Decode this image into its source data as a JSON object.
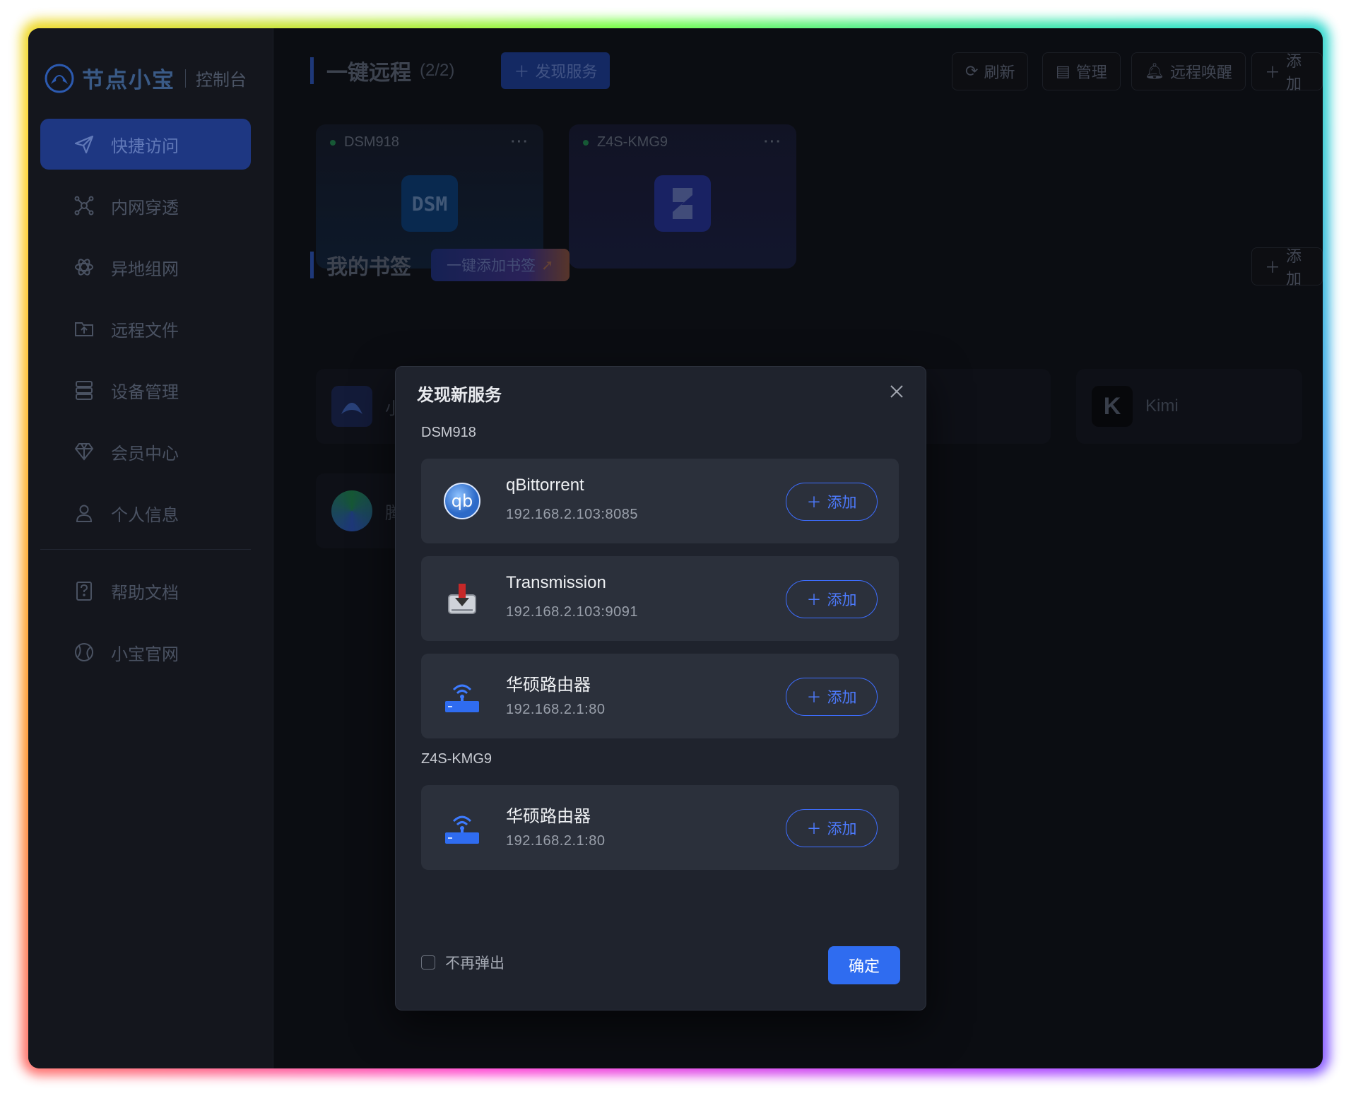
{
  "brand": {
    "name": "节点小宝",
    "subtitle": "控制台"
  },
  "sidebar": {
    "items": [
      {
        "label": "快捷访问",
        "icon": "send-icon",
        "active": true
      },
      {
        "label": "内网穿透",
        "icon": "network-icon"
      },
      {
        "label": "异地组网",
        "icon": "mesh-icon"
      },
      {
        "label": "远程文件",
        "icon": "folder-upload-icon"
      },
      {
        "label": "设备管理",
        "icon": "server-icon"
      },
      {
        "label": "会员中心",
        "icon": "diamond-icon"
      },
      {
        "label": "个人信息",
        "icon": "user-icon"
      }
    ],
    "bottom_items": [
      {
        "label": "帮助文档",
        "icon": "help-doc-icon"
      },
      {
        "label": "小宝官网",
        "icon": "globe-icon"
      }
    ]
  },
  "remote": {
    "title": "一键远程",
    "count": "(2/2)",
    "discover_label": "发现服务",
    "toolbar": {
      "refresh": "刷新",
      "manage": "管理",
      "wake": "远程唤醒",
      "add": "添加"
    },
    "devices": [
      {
        "name": "DSM918",
        "icon": "dsm-icon",
        "icon_text": "DSM"
      },
      {
        "name": "Z4S-KMG9",
        "icon": "zspace-icon"
      }
    ]
  },
  "bookmarks": {
    "title": "我的书签",
    "one_click_add": "一键添加书签",
    "add": "添加",
    "items": [
      {
        "label": "小",
        "icon": "node-logo-icon"
      },
      {
        "label": "Kimi",
        "icon": "kimi-icon"
      },
      {
        "label": "腾",
        "icon": "tencent-icon"
      }
    ]
  },
  "modal": {
    "title": "发现新服务",
    "groups": [
      {
        "device": "DSM918",
        "services": [
          {
            "name": "qBittorrent",
            "address": "192.168.2.103:8085",
            "icon": "qbittorrent-icon",
            "add": "添加"
          },
          {
            "name": "Transmission",
            "address": "192.168.2.103:9091",
            "icon": "transmission-icon",
            "add": "添加"
          },
          {
            "name": "华硕路由器",
            "address": "192.168.2.1:80",
            "icon": "router-icon",
            "add": "添加"
          }
        ]
      },
      {
        "device": "Z4S-KMG9",
        "services": [
          {
            "name": "华硕路由器",
            "address": "192.168.2.1:80",
            "icon": "router-icon",
            "add": "添加"
          }
        ]
      }
    ],
    "dont_show_again": "不再弹出",
    "confirm": "确定"
  },
  "colors": {
    "accent": "#2f6cf0",
    "bg": "#101219",
    "modal_bg": "#1f232d"
  }
}
